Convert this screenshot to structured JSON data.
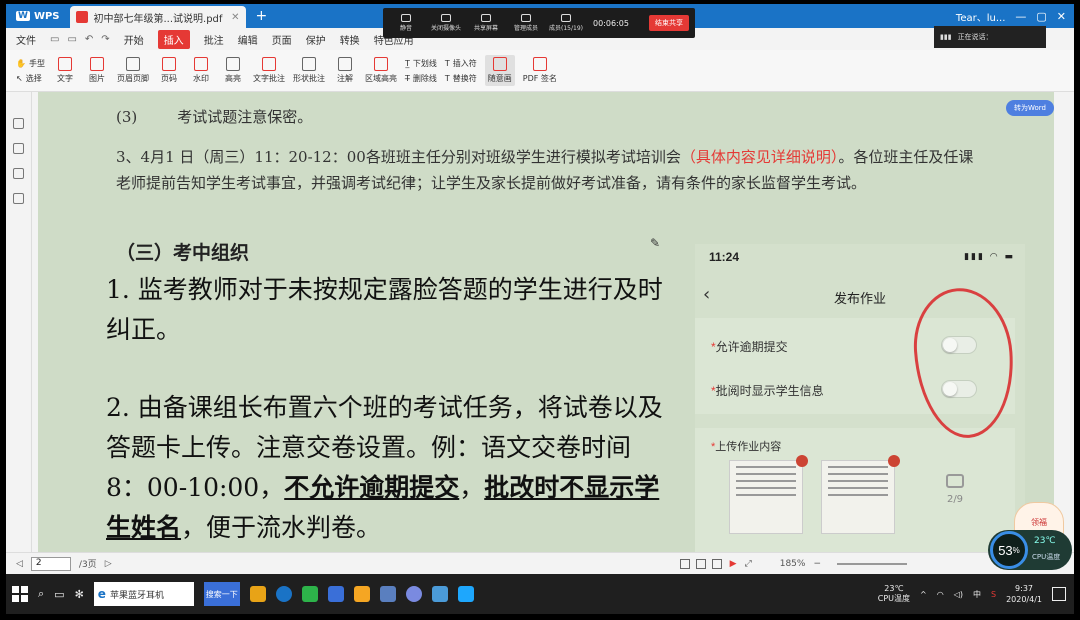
{
  "app": {
    "name": "WPS",
    "tab_title": "初中部七年级第...试说明.pdf",
    "user": "Tear、lu...",
    "colors": {
      "titlebar": "#1a73c6",
      "accent_red": "#e53935",
      "page_bg": "#cfdcc7"
    }
  },
  "meeting": {
    "buttons": [
      "静音",
      "关闭摄像头",
      "共享屏幕",
      "管理成员",
      "成员(15/19)"
    ],
    "timer": "00:06:05",
    "end_label": "结束共享"
  },
  "voice_popup": {
    "label": "正在说话："
  },
  "menu": {
    "file": "文件",
    "items": [
      "开始",
      "插入",
      "批注",
      "编辑",
      "页面",
      "保护",
      "转换",
      "特色应用"
    ],
    "active": "插入"
  },
  "toolbar": {
    "hand": "手型",
    "select": "选择",
    "text": "文字",
    "picture": "图片",
    "header_footer": "页眉页脚",
    "page_num": "页码",
    "watermark": "水印",
    "highlight": "高亮",
    "text_comment": "文字批注",
    "shape_comment": "形状批注",
    "annotate": "注解",
    "area_highlight": "区域高亮",
    "underline": "下划线",
    "strikethrough": "删除线",
    "insert_symbol": "插入符",
    "replace_symbol": "替换符",
    "pen": "随意画",
    "pdf_sign": "PDF 签名"
  },
  "document": {
    "top_num": "(3)",
    "top_text": "考试试题注意保密。",
    "para3_main": "3、4月1 日（周三）11：20-12：00各班班主任分别对班级学生进行模拟考试培训会",
    "para3_red": "（具体内容见详细说明）",
    "para3_rest": "。各位班主任及任课老师提前告知学生考试事宜，并强调考试纪律；让学生及家长提前做好考试准备，请有条件的家长监督学生考试。",
    "section_head": "（三）考中组织",
    "item1": "1. 监考教师对于未按规定露脸答题的学生进行及时纠正。",
    "item2_pre": "2. 由备课组长布置六个班的考试任务，将试卷以及答题卡上传。注意交卷设置。例：语文交卷时间8：00-10:00，",
    "item2_u1": "不允许逾期提交",
    "item2_mid": "，",
    "item2_u2": "批改时不显示学生姓名",
    "item2_end": "，便于流水判卷。",
    "to_word": "转为Word"
  },
  "phone": {
    "time": "11:24",
    "title": "发布作业",
    "opt1": "允许逾期提交",
    "opt2": "批阅时显示学生信息",
    "upload_label": "上传作业内容",
    "photo_count": "2/9"
  },
  "statusbar": {
    "page": "2",
    "total": "/3页",
    "zoom": "185%"
  },
  "cpu_widget": {
    "percent": "53",
    "temp": "23℃",
    "label": "CPU温度",
    "mascot": "领福"
  },
  "taskbar": {
    "ie_label": "苹果蓝牙耳机",
    "search_label": "搜索一下",
    "cpu_temp": "23℃",
    "cpu_label": "CPU温度",
    "ime": "中",
    "time": "9:37",
    "date": "2020/4/1"
  }
}
